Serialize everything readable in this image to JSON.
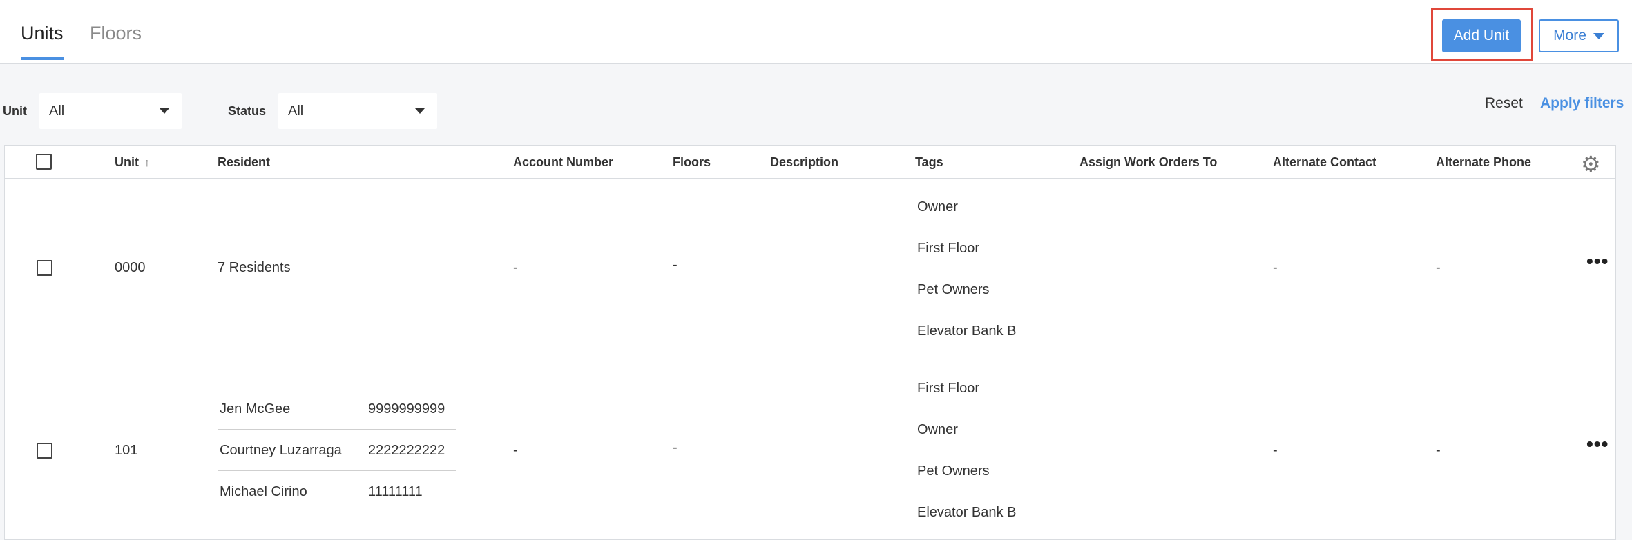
{
  "tabs": [
    {
      "label": "Units",
      "active": true
    },
    {
      "label": "Floors",
      "active": false
    }
  ],
  "actions": {
    "add_unit": "Add Unit",
    "more": "More"
  },
  "filters": {
    "unit_label": "Unit",
    "unit_value": "All",
    "status_label": "Status",
    "status_value": "All",
    "reset": "Reset",
    "apply": "Apply filters"
  },
  "columns": [
    "Unit",
    "Resident",
    "Account Number",
    "Floors",
    "Description",
    "Tags",
    "Assign Work Orders To",
    "Alternate Contact",
    "Alternate Phone"
  ],
  "rows": [
    {
      "unit": "0000",
      "resident": "7 Residents",
      "account_number": "-",
      "floors": "-",
      "tags": [
        "Owner",
        "First Floor",
        "Pet Owners",
        "Elevator Bank B"
      ],
      "alternate_contact": "-",
      "alternate_phone": "-"
    },
    {
      "unit": "101",
      "residents": [
        {
          "name": "Jen McGee",
          "phone": "9999999999"
        },
        {
          "name": "Courtney Luzarraga",
          "phone": "2222222222"
        },
        {
          "name": "Michael Cirino",
          "phone": "11111111"
        }
      ],
      "account_number": "-",
      "floors": "-",
      "tags": [
        "First Floor",
        "Owner",
        "Pet Owners",
        "Elevator Bank B"
      ],
      "alternate_contact": "-",
      "alternate_phone": "-"
    }
  ],
  "icons": {
    "sort": "sort-ascending-icon",
    "settings": "gear-icon",
    "row_menu": "more-horizontal-icon"
  },
  "colors": {
    "accent": "#4a90e2",
    "highlight": "#e0473a"
  }
}
